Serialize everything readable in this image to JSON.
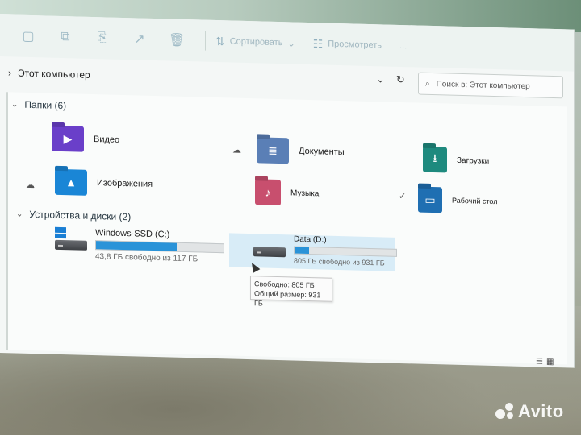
{
  "toolbar": {
    "sort_label": "Сортировать",
    "view_label": "Просмотреть",
    "more_label": "...",
    "sort_icon": "sort-arrows-icon",
    "view_icon": "view-layout-icon"
  },
  "address": {
    "location": "Этот компьютер",
    "search_placeholder": "Поиск в: Этот компьютер"
  },
  "folders_group": {
    "header": "Папки (6)",
    "items": [
      {
        "label": "Видео",
        "icon": "video-folder-icon",
        "color": "#6a3fc9"
      },
      {
        "label": "Документы",
        "icon": "documents-folder-icon",
        "color": "#5a7fb6"
      },
      {
        "label": "Загрузки",
        "icon": "downloads-folder-icon",
        "color": "#1e8a7e"
      },
      {
        "label": "Изображения",
        "icon": "pictures-folder-icon",
        "color": "#1a86d6"
      },
      {
        "label": "Музыка",
        "icon": "music-folder-icon",
        "color": "#c84f6e"
      },
      {
        "label": "Рабочий стол",
        "icon": "desktop-folder-icon",
        "color": "#1f6fb2"
      }
    ]
  },
  "drives_group": {
    "header": "Устройства и диски (2)",
    "items": [
      {
        "name": "Windows-SSD (C:)",
        "free_text": "43,8 ГБ свободно из 117 ГБ",
        "used_fraction": 0.63,
        "icon": "windows-drive-icon"
      },
      {
        "name": "Data (D:)",
        "free_text": "805 ГБ свободно из 931 ГБ",
        "used_fraction": 0.14,
        "icon": "hard-drive-icon"
      }
    ]
  },
  "tooltip": {
    "line1": "Свободно: 805 ГБ",
    "line2": "Общий размер: 931 ГБ"
  },
  "watermark": {
    "text": "Avito"
  },
  "colors": {
    "accent": "#2a93d8",
    "selection": "#cce7f5"
  }
}
